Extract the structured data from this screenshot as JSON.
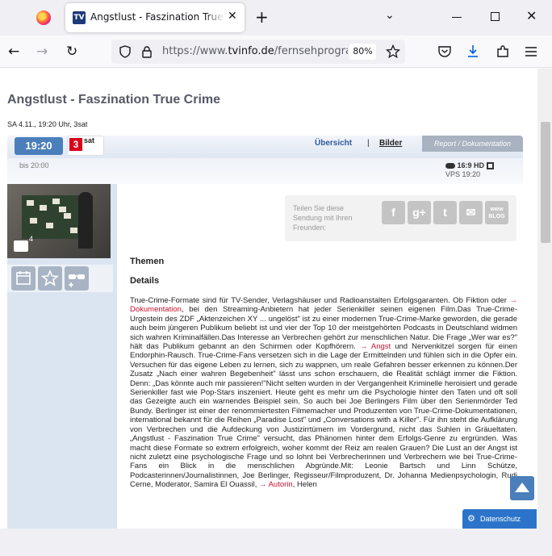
{
  "browser": {
    "tab_title": "Angstlust - Faszination True Crime",
    "tab_favicon": "TV",
    "url_prefix": "https://www.",
    "url_domain": "tvinfo.de",
    "url_path": "/fernsehprogramm",
    "zoom": "80%",
    "icons": [
      "firefox-logo-icon",
      "close-icon",
      "plus-icon",
      "chevron-down-icon",
      "minimize-icon",
      "maximize-icon",
      "back-icon",
      "forward-icon",
      "reload-icon",
      "shield-icon",
      "lock-icon",
      "star-icon",
      "pocket-icon",
      "download-icon",
      "extensions-icon",
      "menu-icon"
    ]
  },
  "page": {
    "title": "Angstlust - Faszination True Crime",
    "subtitle": "SA 4.11., 19:20 Uhr, 3sat",
    "time": "19:20",
    "channel_num": "3",
    "channel_name": "sat",
    "tab_overview": "Übersicht",
    "separator": "|",
    "tab_pictures": "Bilder",
    "genre": "Report / Dokumentation",
    "until": "bis 20:00",
    "format_badge": "16:9 HD",
    "vps": "VPS 19:20",
    "photo_count": "4",
    "share_text": "Teilen Sie diese Sendung mit Ihren Freunden:",
    "social": [
      "f",
      "g+",
      "t",
      "✉",
      "www BLOG"
    ],
    "heading_themen": "Themen",
    "heading_details": "Details",
    "details_text_1": "True-Crime-Formate sind für TV-Sender, Verlagshäuser und Radioanstalten Erfolgsgaranten. Ob Fiktion oder ",
    "details_link_1": "→ Dokumentation",
    "details_text_2": ", bei den Streaming-Anbietern hat jeder Serienkiller seinen eigenen Film.Das True-Crime-Urgestein des ZDF „Aktenzeichen XY ... ungelöst\" ist zu einer modernen True-Crime-Marke geworden, die gerade auch beim jüngeren Publikum beliebt ist und vier der Top 10 der meistgehörten Podcasts in Deutschland widmen sich wahren Kriminalfällen.Das Interesse an Verbrechen gehört zur menschlichen Natur. Die Frage „Wer war es?\" hält das Publikum gebannt an den Schirmen oder Kopfhörern. ",
    "details_link_2": "→ Angst",
    "details_text_3": " und Nervenkitzel sorgen für einen Endorphin-Rausch. True-Crime-Fans versetzen sich in die Lage der Ermittelnden und fühlen sich in die Opfer ein. Versuchen für das eigene Leben zu lernen, sich zu wappnen, um reale Gefahren besser erkennen zu können.Der Zusatz „Nach einer wahren Begebenheit\" lässt uns schon erschauern, die Realität schlägt immer die Fiktion. Denn: „Das könnte auch mir passieren!\"Nicht selten wurden in der Vergangenheit Kriminelle heroisiert und gerade Serienkiller fast wie Pop-Stars inszeniert. Heute geht es mehr um die Psychologie hinter den Taten und oft soll das Gezeigte auch ein warnendes Beispiel sein. So auch bei Joe Berlingers Film über den Serienmörder Ted Bundy. Berlinger ist einer der renommiertesten Filmemacher und Produzenten von True-Crime-Dokumentationen, international bekannt für die Reihen „Paradise Lost\" und „Conversations with a Killer\". Für ihn steht die Aufklärung von Verbrechen und die Aufdeckung von Justizirrtümern im Vordergrund, nicht das Suhlen in Gräueltaten.„Angstlust - Faszination True Crime\" versucht, das Phänomen hinter dem Erfolgs-Genre zu ergründen. Was macht diese Formate so extrem erfolgreich, woher kommt der Reiz am realen Grauen? Die Lust an der Angst ist nicht zuletzt eine psychologische Frage und so lohnt bei Verbrecherinnen und Verbrechern wie bei True-Crime-Fans ein Blick in die menschlichen Abgründe.Mit: Leonie Bartsch und Linn Schütze, Podcasterinnen/Journalistinnen, Joe Berlinger, Regisseur/Filmproduzent, Dr. Johanna Medienpsychologin, Rudi Cerne, Moderator, Samira El Ouassil, ",
    "details_link_3": "→ Autorin",
    "details_text_4": ", Helen",
    "datenschutz": "Datenschutz"
  },
  "colors": {
    "accent": "#4a7fbb",
    "link_red": "#c8102e",
    "channel_red": "#d9001b"
  }
}
